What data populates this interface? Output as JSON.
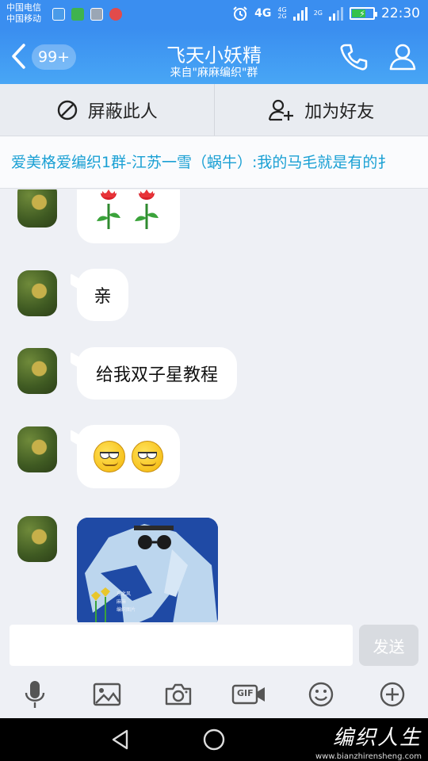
{
  "status_bar": {
    "carrier_1": "中国电信",
    "carrier_2": "中国移动",
    "network": "4G",
    "network_small_1": "4G",
    "network_small_2": "2G",
    "network_small_3": "2G",
    "time": "22:30"
  },
  "header": {
    "unread_badge": "99+",
    "title": "飞天小妖精",
    "subtitle": "来自\"麻麻编织\"群"
  },
  "actions": {
    "block_label": "屏蔽此人",
    "add_friend_label": "加为好友"
  },
  "notice": {
    "text": "爱美格爱编织1群-江苏一雪（蜗牛）:我的马毛就是有的扌"
  },
  "messages": [
    {
      "type": "emoji",
      "content": "roses"
    },
    {
      "type": "text",
      "content": "亲"
    },
    {
      "type": "text",
      "content": "给我双子星教程"
    },
    {
      "type": "emoji",
      "content": "smug-faces"
    },
    {
      "type": "image",
      "content": "sweater-photo"
    }
  ],
  "photo_caption": {
    "line1": "东北风",
    "line2": "麻麻",
    "line3": "编织图片"
  },
  "composer": {
    "input_value": "",
    "send_label": "发送"
  },
  "toolbar": {
    "gif_label": "GIF"
  },
  "watermark": {
    "brand": "编织人生",
    "url": "www.bianzhirensheng.com"
  },
  "colors": {
    "header_blue": "#3a8ef0",
    "notice_text": "#1aa0d4",
    "send_disabled": "#d8dbe0"
  }
}
